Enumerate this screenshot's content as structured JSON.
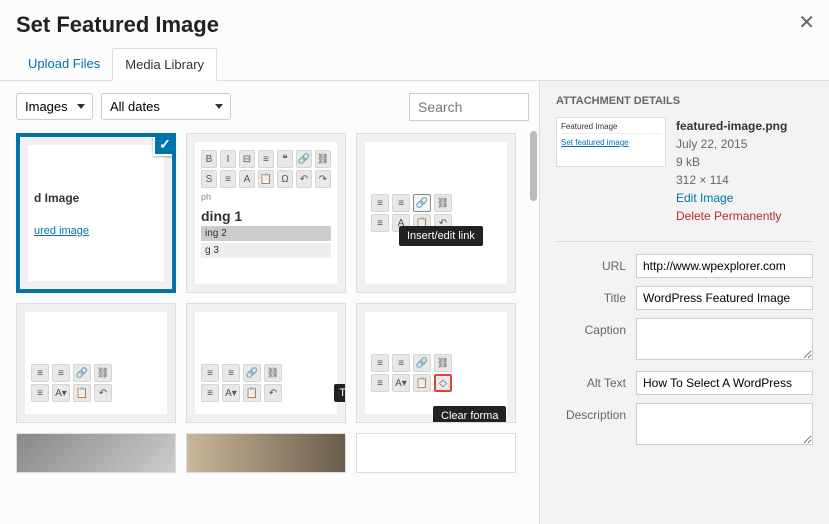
{
  "title": "Set Featured Image",
  "tabs": {
    "upload": "Upload Files",
    "library": "Media Library"
  },
  "filters": {
    "type": "Images",
    "date": "All dates"
  },
  "search_placeholder": "Search",
  "tooltips": {
    "insert_link": "Insert/edit link",
    "clear_format": "Clear forma",
    "t_fragment": "T"
  },
  "thumb1": {
    "heading": "d Image",
    "link": "ured image"
  },
  "thumb2": {
    "label_ph": "ph",
    "h1": "ding 1",
    "h2": "ing 2",
    "h3": "g 3"
  },
  "panel": {
    "title": "ATTACHMENT DETAILS",
    "preview": {
      "title": "Featured Image",
      "link": "Set featured image"
    },
    "filename": "featured-image.png",
    "date": "July 22, 2015",
    "size": "9 kB",
    "dimensions": "312 × 114",
    "edit": "Edit Image",
    "delete": "Delete Permanently",
    "fields": {
      "url_label": "URL",
      "url_value": "http://www.wpexplorer.com",
      "title_label": "Title",
      "title_value": "WordPress Featured Image",
      "caption_label": "Caption",
      "caption_value": "",
      "alt_label": "Alt Text",
      "alt_value": "How To Select A WordPress",
      "desc_label": "Description",
      "desc_value": ""
    }
  }
}
